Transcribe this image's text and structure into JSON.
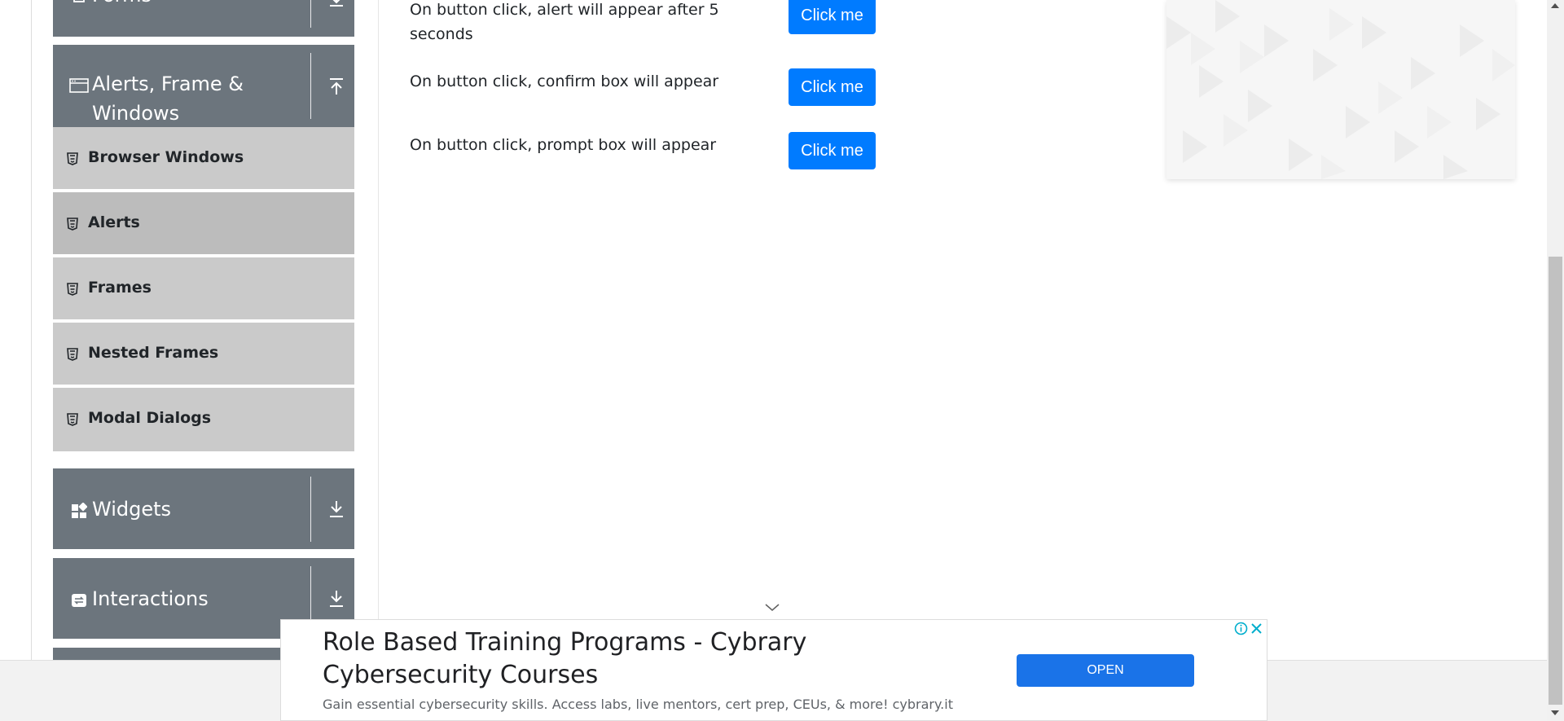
{
  "sidebar": {
    "forms_label": "Forms",
    "alerts_group_label": "Alerts, Frame & Windows",
    "items": [
      {
        "label": "Browser Windows"
      },
      {
        "label": "Alerts"
      },
      {
        "label": "Frames"
      },
      {
        "label": "Nested Frames"
      },
      {
        "label": "Modal Dialogs"
      }
    ],
    "widgets_label": "Widgets",
    "interactions_label": "Interactions"
  },
  "main": {
    "rows": [
      {
        "text": "On button click, alert will appear after 5 seconds",
        "button": "Click me"
      },
      {
        "text": "On button click, confirm box will appear",
        "button": "Click me"
      },
      {
        "text": "On button click, prompt box will appear",
        "button": "Click me"
      }
    ]
  },
  "ad": {
    "title": "Role Based Training Programs - Cybrary Cybersecurity Courses",
    "description": "Gain essential cybersecurity skills. Access labs, live mentors, cert prep, CEUs, & more! cybrary.it",
    "open_label": "OPEN"
  },
  "colors": {
    "sidebar_header": "#6c757d",
    "sidebar_item": "#cacaca",
    "sidebar_item_active": "#bcbcbc",
    "button_primary": "#007bff",
    "ad_button": "#1a73e8"
  }
}
